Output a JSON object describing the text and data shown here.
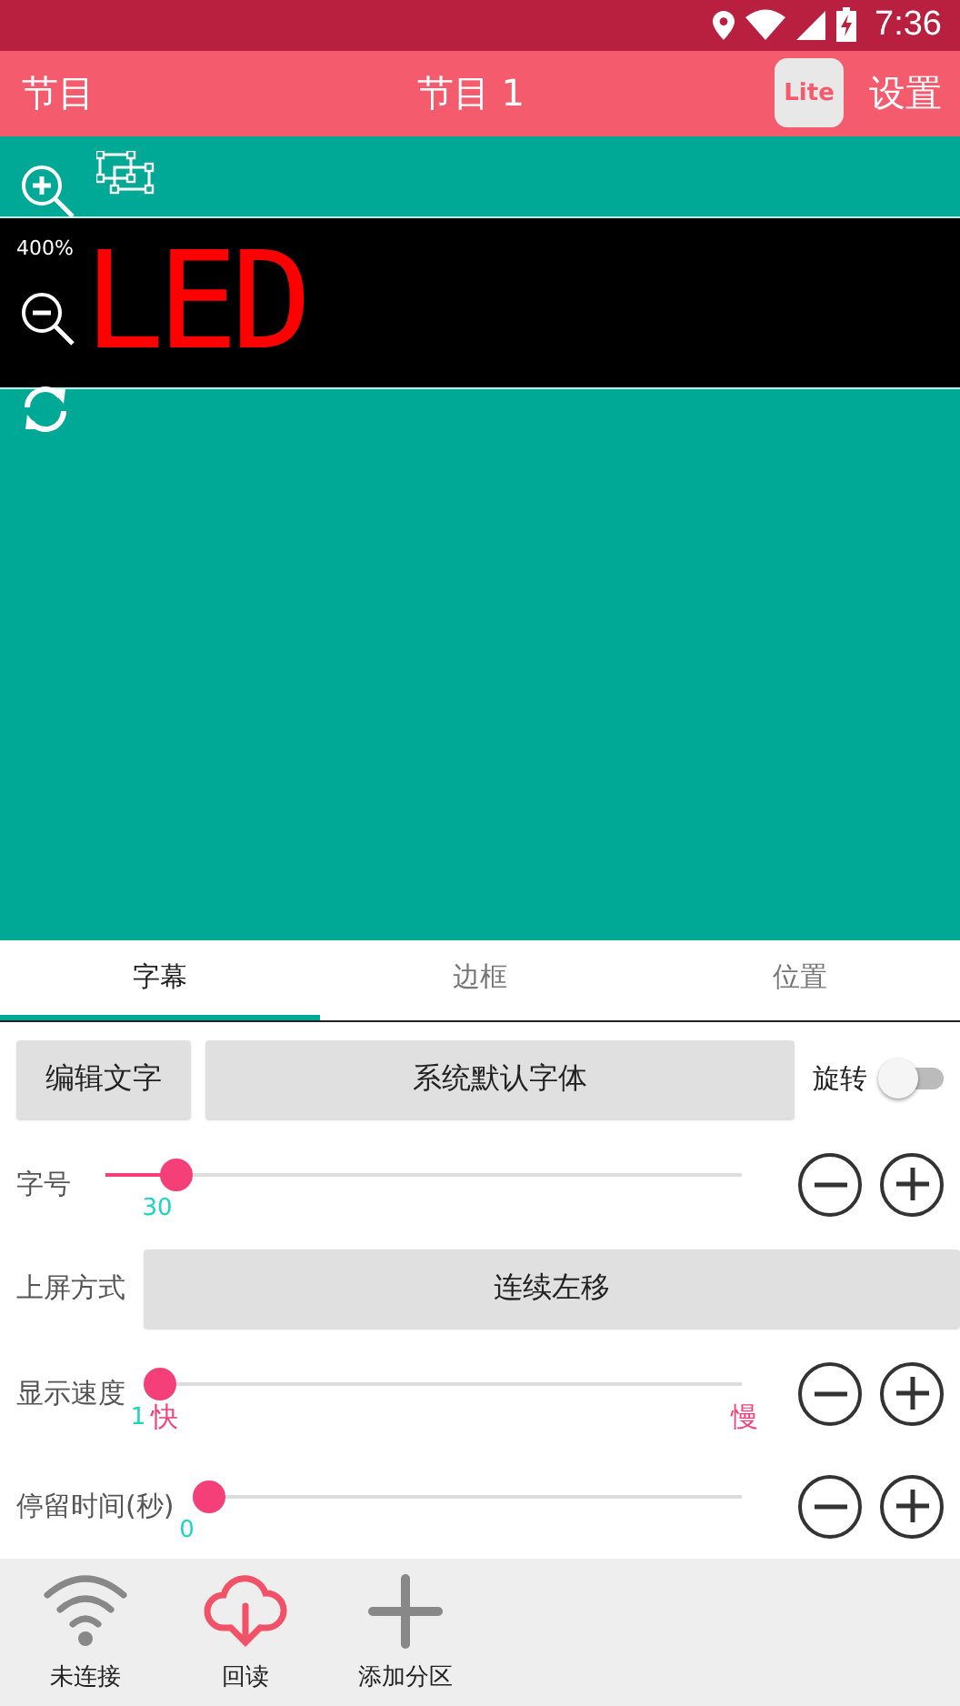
{
  "status_bar": {
    "time": "7:36"
  },
  "app_bar": {
    "left": "节目",
    "title": "节目 1",
    "badge": "Lite",
    "right": "设置"
  },
  "preview": {
    "zoom": "400%",
    "led_text": "LED"
  },
  "tabs": [
    {
      "label": "字幕",
      "selected": true
    },
    {
      "label": "边框",
      "selected": false
    },
    {
      "label": "位置",
      "selected": false
    }
  ],
  "text_settings": {
    "edit_button": "编辑文字",
    "font_button": "系统默认字体",
    "rotate": {
      "label": "旋转",
      "on": false
    }
  },
  "rows": [
    {
      "kind": "slider",
      "label": "字号",
      "level": 0.11,
      "reading": "30"
    },
    {
      "kind": "select",
      "label": "上屏方式",
      "value": "连续左移"
    },
    {
      "kind": "slider",
      "label": "显示速度",
      "level": 0,
      "reading": "1",
      "min_label": "快",
      "max_label": "慢"
    },
    {
      "kind": "slider",
      "label": "停留时间(秒)",
      "level": 0,
      "reading": "0"
    }
  ],
  "bottom_nav": [
    {
      "kind": "wifi",
      "label": "未连接"
    },
    {
      "kind": "download",
      "label": "回读"
    },
    {
      "kind": "add",
      "label": "添加分区"
    }
  ]
}
